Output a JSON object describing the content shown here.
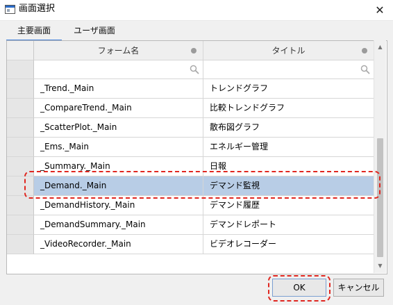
{
  "window": {
    "title": "画面選択",
    "close": "✕"
  },
  "tabs": [
    {
      "label": "主要画面",
      "active": true
    },
    {
      "label": "ユーザ画面",
      "active": false
    }
  ],
  "table": {
    "columns": [
      "フォーム名",
      "タイトル"
    ],
    "rows": [
      {
        "form": "_Trend._Main",
        "title": "トレンドグラフ"
      },
      {
        "form": "_CompareTrend._Main",
        "title": "比較トレンドグラフ"
      },
      {
        "form": "_ScatterPlot._Main",
        "title": "散布図グラフ"
      },
      {
        "form": "_Ems._Main",
        "title": "エネルギー管理"
      },
      {
        "form": "_Summary._Main",
        "title": "日報"
      },
      {
        "form": "_Demand._Main",
        "title": "デマンド監視",
        "selected": true
      },
      {
        "form": "_DemandHistory._Main",
        "title": "デマンド履歴"
      },
      {
        "form": "_DemandSummary._Main",
        "title": "デマンドレポート"
      },
      {
        "form": "_VideoRecorder._Main",
        "title": "ビデオレコーダー"
      }
    ]
  },
  "buttons": {
    "ok": "OK",
    "cancel": "キャンセル"
  },
  "scroll": {
    "up": "▲",
    "down": "▼"
  },
  "colors": {
    "selection": "#b8cde6",
    "accent": "#3d7dd8",
    "highlight": "#e0261f"
  }
}
